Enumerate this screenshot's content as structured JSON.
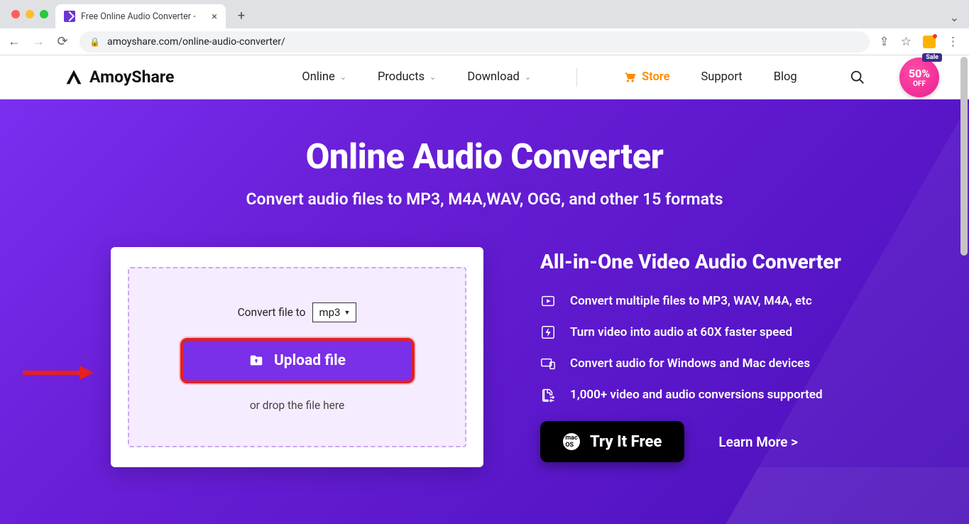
{
  "browser": {
    "tab_title": "Free Online Audio Converter - ",
    "url": "amoyshare.com/online-audio-converter/"
  },
  "header": {
    "brand": "AmoyShare",
    "nav": {
      "online": "Online",
      "products": "Products",
      "download": "Download",
      "store": "Store",
      "support": "Support",
      "blog": "Blog"
    },
    "sale": {
      "tag": "Sale",
      "percent": "50%",
      "off": "OFF"
    }
  },
  "hero": {
    "title": "Online Audio Converter",
    "subtitle": "Convert audio files to MP3, M4A,WAV, OGG, and other 15 formats"
  },
  "upload": {
    "convert_label": "Convert file to",
    "format": "mp3",
    "button": "Upload file",
    "drop": "or drop the file here"
  },
  "promo": {
    "title": "All-in-One Video Audio Converter",
    "features": [
      "Convert multiple files to MP3, WAV, M4A, etc",
      "Turn video into audio at 60X faster speed",
      "Convert audio for Windows and Mac devices",
      "1,000+ video and audio conversions supported"
    ],
    "try": "Try It Free",
    "learn": "Learn More >"
  }
}
